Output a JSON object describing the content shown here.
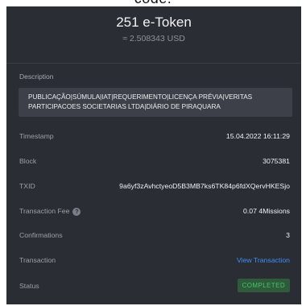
{
  "top_strip_text": "code.",
  "header": {
    "amount": "251 e-Token",
    "usd": "≈ 2.508343 USD"
  },
  "description": {
    "label": "Description",
    "text": "PUBLICAÇÃO|SÚMULA|IAT|REQUERIMENTO|LICENÇA PRÉVIA|VERITAS PARTICIPACOES SOCIETARIAS LTDA|DIÁRIO DE PIRAQUARA"
  },
  "rows": {
    "timestamp": {
      "label": "Timestamp",
      "value": "15.04.2022 16:11:29"
    },
    "block": {
      "label": "Block",
      "value": "3075381"
    },
    "txid": {
      "label": "TXID",
      "value": "9a6yf3zAvhctyeoD5B3MB7ks6TK84p6fdXQervHKESjo"
    },
    "fee": {
      "label": "Transaction Fee",
      "value": "0.07 4Missions",
      "help_icon": "question-circle-icon"
    },
    "confirmations": {
      "label": "Confirmations",
      "value": "3"
    },
    "transaction": {
      "label": "Transaction",
      "value": "View Transaction"
    },
    "status": {
      "label": "Status",
      "value": "COMPLETED"
    }
  },
  "colors": {
    "panel_bg": "#2a2d34",
    "link": "#3f8ef7",
    "status_text": "#42c765",
    "status_bg": "#2f5a3b"
  }
}
